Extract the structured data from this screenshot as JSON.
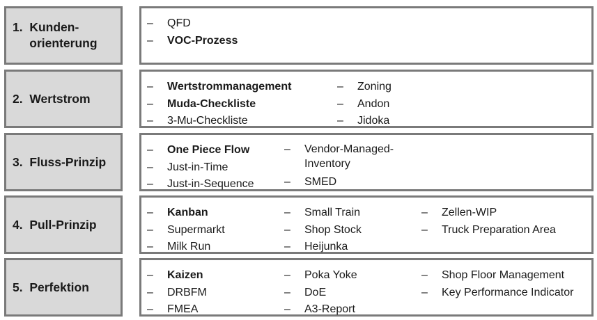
{
  "rows": [
    {
      "label_lines": [
        "1.  Kunden-",
        "     orienterung"
      ],
      "columns": [
        [
          {
            "text": "QFD",
            "bold": false
          },
          {
            "text": "VOC-Prozess",
            "bold": true
          }
        ]
      ]
    },
    {
      "label_lines": [
        "2.  Wertstrom"
      ],
      "columns": [
        [
          {
            "text": "Wertstrommanagement",
            "bold": true
          },
          {
            "text": "Muda-Checkliste",
            "bold": true
          },
          {
            "text": "3-Mu-Checkliste",
            "bold": false
          }
        ],
        [
          {
            "text": "Zoning",
            "bold": false
          },
          {
            "text": "Andon",
            "bold": false
          },
          {
            "text": "Jidoka",
            "bold": false
          }
        ]
      ]
    },
    {
      "label_lines": [
        "3.  Fluss-Prinzip"
      ],
      "columns": [
        [
          {
            "text": "One Piece Flow",
            "bold": true
          },
          {
            "text": "Just-in-Time",
            "bold": false
          },
          {
            "text": "Just-in-Sequence",
            "bold": false
          }
        ],
        [
          {
            "text": "Vendor-Managed-Inventory",
            "bold": false
          },
          {
            "text": "SMED",
            "bold": false
          }
        ]
      ]
    },
    {
      "label_lines": [
        "4.  Pull-Prinzip"
      ],
      "columns": [
        [
          {
            "text": "Kanban",
            "bold": true
          },
          {
            "text": "Supermarkt",
            "bold": false
          },
          {
            "text": "Milk Run",
            "bold": false
          }
        ],
        [
          {
            "text": "Small Train",
            "bold": false
          },
          {
            "text": "Shop Stock",
            "bold": false
          },
          {
            "text": "Heijunka",
            "bold": false
          }
        ],
        [
          {
            "text": "Zellen-WIP",
            "bold": false
          },
          {
            "text": "Truck Preparation Area",
            "bold": false
          }
        ]
      ]
    },
    {
      "label_lines": [
        "5.  Perfektion"
      ],
      "columns": [
        [
          {
            "text": "Kaizen",
            "bold": true
          },
          {
            "text": "DRBFM",
            "bold": false
          },
          {
            "text": "FMEA",
            "bold": false
          }
        ],
        [
          {
            "text": "Poka Yoke",
            "bold": false
          },
          {
            "text": "DoE",
            "bold": false
          },
          {
            "text": "A3-Report",
            "bold": false
          }
        ],
        [
          {
            "text": "Shop Floor Management",
            "bold": false
          },
          {
            "text": "Key Performance Indicator",
            "bold": false
          }
        ]
      ]
    }
  ],
  "dash_symbol": "–"
}
